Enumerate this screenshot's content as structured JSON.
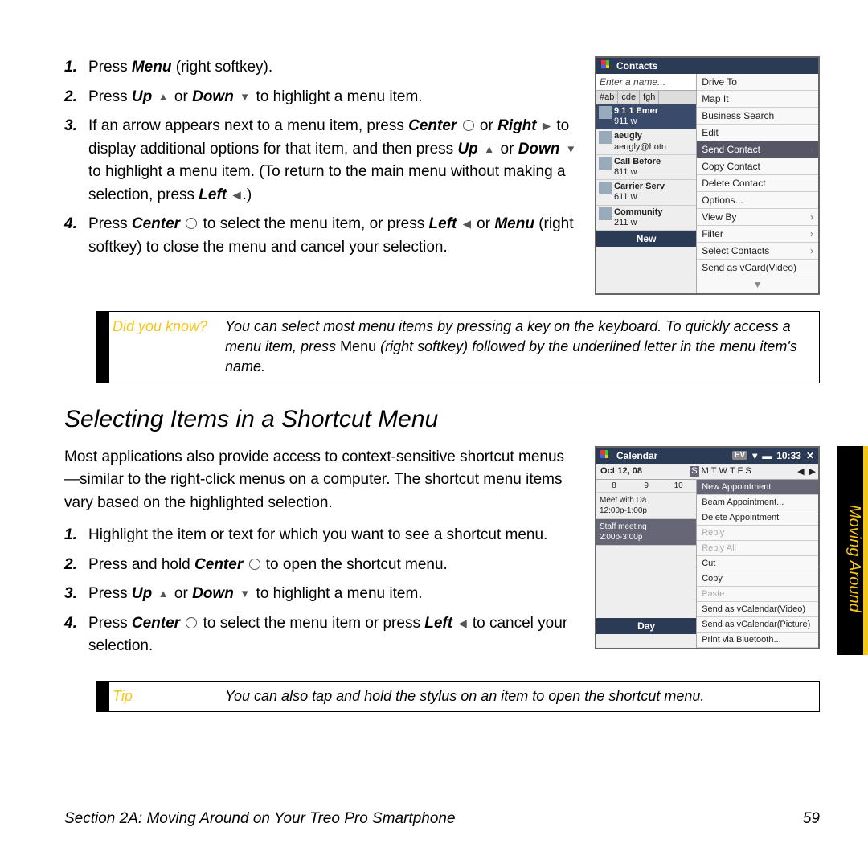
{
  "steps1": [
    {
      "n": "1.",
      "html": "Press <span class='bi'>Menu</span> (right softkey)."
    },
    {
      "n": "2.",
      "html": "Press <span class='bi'>Up</span> <span class='glyph'>▲</span> or <span class='bi'>Down</span> <span class='glyph'>▼</span> to highlight a menu item."
    },
    {
      "n": "3.",
      "html": "If an arrow appears next to a menu item, press <span class='bi'>Center</span> <span class='glyph circle'></span> or <span class='bi'>Right</span> <span class='glyph'>▶</span> to display additional options for that item, and then press <span class='bi'>Up</span> <span class='glyph'>▲</span> or <span class='bi'>Down</span> <span class='glyph'>▼</span> to highlight a menu item. (To return to the main menu without making a selection, press <span class='bi'>Left</span> <span class='glyph'>◀</span>.)"
    },
    {
      "n": "4.",
      "html": "Press <span class='bi'>Center</span> <span class='glyph circle'></span> to select the menu item, or press <span class='bi'>Left</span> <span class='glyph'>◀</span> or <span class='bi'>Menu</span> (right softkey) to close the menu and cancel your selection."
    }
  ],
  "callout1": {
    "label": "Did you know?",
    "body": "You can select most menu items by pressing a key on the keyboard. To quickly access a menu item, press <span class='rm'>Menu</span> (right softkey) followed by the underlined letter in the menu item's name."
  },
  "section_heading": "Selecting Items in a Shortcut Menu",
  "intro": "Most applications also provide access to context-sensitive shortcut menus—similar to the right-click menus on a computer. The shortcut menu items vary based on the highlighted selection.",
  "steps2": [
    {
      "n": "1.",
      "html": "Highlight the item or text for which you want to see a shortcut menu."
    },
    {
      "n": "2.",
      "html": "Press and hold <span class='bi'>Center</span> <span class='glyph circle'></span> to open the shortcut menu."
    },
    {
      "n": "3.",
      "html": "Press <span class='bi'>Up</span> <span class='glyph'>▲</span> or <span class='bi'>Down</span> <span class='glyph'>▼</span> to highlight a menu item."
    },
    {
      "n": "4.",
      "html": "Press <span class='bi'>Center</span> <span class='glyph circle'></span> to select the menu item or press <span class='bi'>Left</span> <span class='glyph'>◀</span> to cancel your selection."
    }
  ],
  "callout2": {
    "label": "Tip",
    "body": "You can also tap and hold the stylus on an item to open the shortcut menu."
  },
  "sidetab": "Moving Around",
  "footer_left": "Section 2A: Moving Around on Your Treo Pro Smartphone",
  "footer_right": "59",
  "shot1": {
    "title": "Contacts",
    "input": "Enter a name...",
    "tabs": [
      "#ab",
      "cde",
      "fgh"
    ],
    "entries": [
      {
        "main": "9 1 1 Emer",
        "sub": "911 w",
        "sel": true
      },
      {
        "main": "aeugly",
        "sub": "aeugly@hotn"
      },
      {
        "main": "Call Before",
        "sub": "811 w"
      },
      {
        "main": "Carrier Serv",
        "sub": "611 w"
      },
      {
        "main": "Community",
        "sub": "211 w"
      }
    ],
    "new": "New",
    "menu": [
      {
        "t": "Drive To"
      },
      {
        "t": "Map It"
      },
      {
        "t": "Business Search"
      },
      {
        "t": "Edit"
      },
      {
        "t": "Send Contact",
        "sel": true,
        "arrow": true
      },
      {
        "t": "Copy Contact"
      },
      {
        "t": "Delete Contact"
      },
      {
        "t": "Options..."
      },
      {
        "t": "View By",
        "arrow": true
      },
      {
        "t": "Filter",
        "arrow": true
      },
      {
        "t": "Select Contacts",
        "arrow": true
      },
      {
        "t": "Send as vCard(Video)"
      }
    ]
  },
  "shot2": {
    "title": "Calendar",
    "time": "10:33",
    "date": "Oct 12, 08",
    "days": [
      "S",
      "M",
      "T",
      "W",
      "T",
      "F",
      "S"
    ],
    "day_sel": 0,
    "hours": [
      "8",
      "9",
      "10"
    ],
    "appts": [
      {
        "t": "Meet with Da",
        "s": "12:00p-1:00p"
      },
      {
        "t": "Staff meeting",
        "s": "2:00p-3:00p",
        "sel": true
      }
    ],
    "day": "Day",
    "menu": [
      {
        "t": "New Appointment",
        "sel": true
      },
      {
        "t": "Beam Appointment..."
      },
      {
        "t": "Delete Appointment"
      },
      {
        "t": "Reply",
        "dis": true
      },
      {
        "t": "Reply All",
        "dis": true
      },
      {
        "t": "Cut"
      },
      {
        "t": "Copy"
      },
      {
        "t": "Paste",
        "dis": true
      },
      {
        "t": "Send as vCalendar(Video)"
      },
      {
        "t": "Send as vCalendar(Picture)"
      },
      {
        "t": "Print via Bluetooth..."
      }
    ]
  }
}
